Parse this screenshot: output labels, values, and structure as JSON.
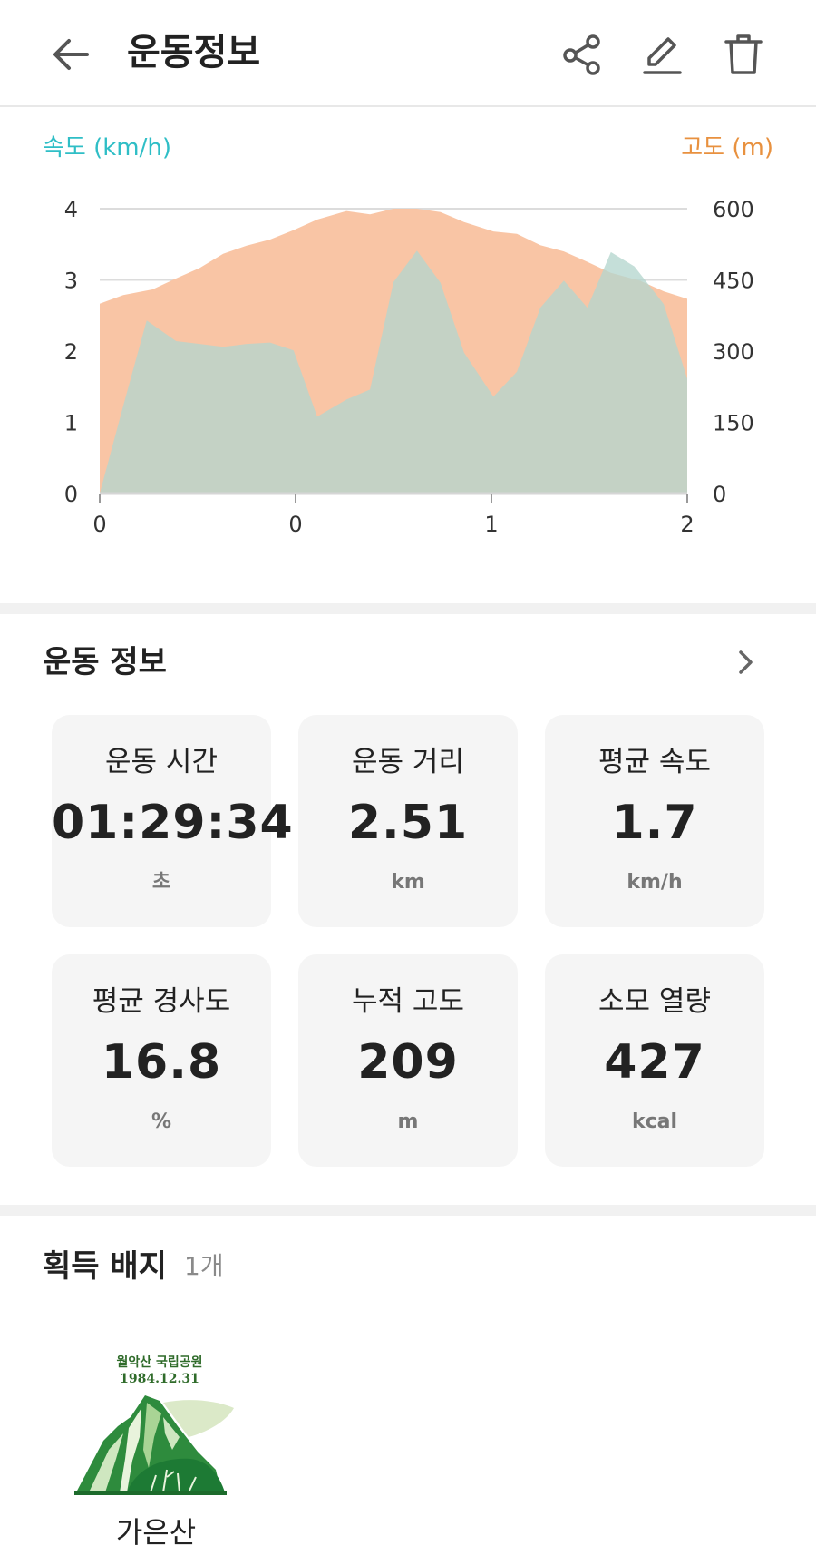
{
  "header": {
    "title": "운동정보",
    "icons": [
      "back-arrow-icon",
      "share-icon",
      "edit-icon",
      "trash-icon"
    ]
  },
  "chart_data": {
    "type": "area",
    "left_axis_label": "속도 (km/h)",
    "right_axis_label": "고도 (m)",
    "left_color": "#2fbec6",
    "right_color": "#e8913f",
    "x_ticks": [
      "0",
      "0",
      "1",
      "2"
    ],
    "left_ticks": [
      "0",
      "1",
      "2",
      "3",
      "4"
    ],
    "right_ticks": [
      "0",
      "150",
      "300",
      "450",
      "600"
    ],
    "left_ylim": [
      0,
      4
    ],
    "right_ylim": [
      0,
      600
    ],
    "grid": true,
    "series": [
      {
        "name": "고도 (m)",
        "axis": "right",
        "fill": "#f9c5a5",
        "x": [
          0,
          0.04,
          0.09,
          0.13,
          0.17,
          0.21,
          0.25,
          0.29,
          0.33,
          0.37,
          0.42,
          0.46,
          0.5,
          0.54,
          0.58,
          0.62,
          0.67,
          0.71,
          0.75,
          0.79,
          0.83,
          0.87,
          0.92,
          0.96,
          1.0
        ],
        "values": [
          400,
          418,
          430,
          453,
          475,
          505,
          522,
          535,
          555,
          577,
          595,
          588,
          600,
          600,
          593,
          572,
          552,
          547,
          523,
          510,
          488,
          465,
          448,
          426,
          410
        ]
      },
      {
        "name": "속도 (km/h)",
        "axis": "left",
        "fill": "#b5d6ce",
        "x": [
          0,
          0.04,
          0.08,
          0.13,
          0.17,
          0.21,
          0.25,
          0.29,
          0.33,
          0.37,
          0.42,
          0.46,
          0.5,
          0.54,
          0.58,
          0.62,
          0.67,
          0.71,
          0.75,
          0.79,
          0.83,
          0.87,
          0.91,
          0.96,
          1.0
        ],
        "values": [
          0,
          1.23,
          2.43,
          2.14,
          2.1,
          2.06,
          2.1,
          2.12,
          2.01,
          1.08,
          1.32,
          1.46,
          2.97,
          3.41,
          2.96,
          1.98,
          1.36,
          1.71,
          2.61,
          2.99,
          2.61,
          3.39,
          3.19,
          2.66,
          1.61
        ]
      }
    ]
  },
  "stats": {
    "section_title": "운동 정보",
    "cards": [
      {
        "label": "운동 시간",
        "value": "01:29:34",
        "unit": "초"
      },
      {
        "label": "운동 거리",
        "value": "2.51",
        "unit": "km"
      },
      {
        "label": "평균 속도",
        "value": "1.7",
        "unit": "km/h"
      },
      {
        "label": "평균 경사도",
        "value": "16.8",
        "unit": "%"
      },
      {
        "label": "누적 고도",
        "value": "209",
        "unit": "m"
      },
      {
        "label": "소모 열량",
        "value": "427",
        "unit": "kcal"
      }
    ]
  },
  "badges": {
    "title": "획득 배지",
    "count": "1개",
    "items": [
      {
        "name": "가은산",
        "seal_line1": "월악산 국립공원",
        "seal_line2": "1984.12.31"
      }
    ]
  }
}
